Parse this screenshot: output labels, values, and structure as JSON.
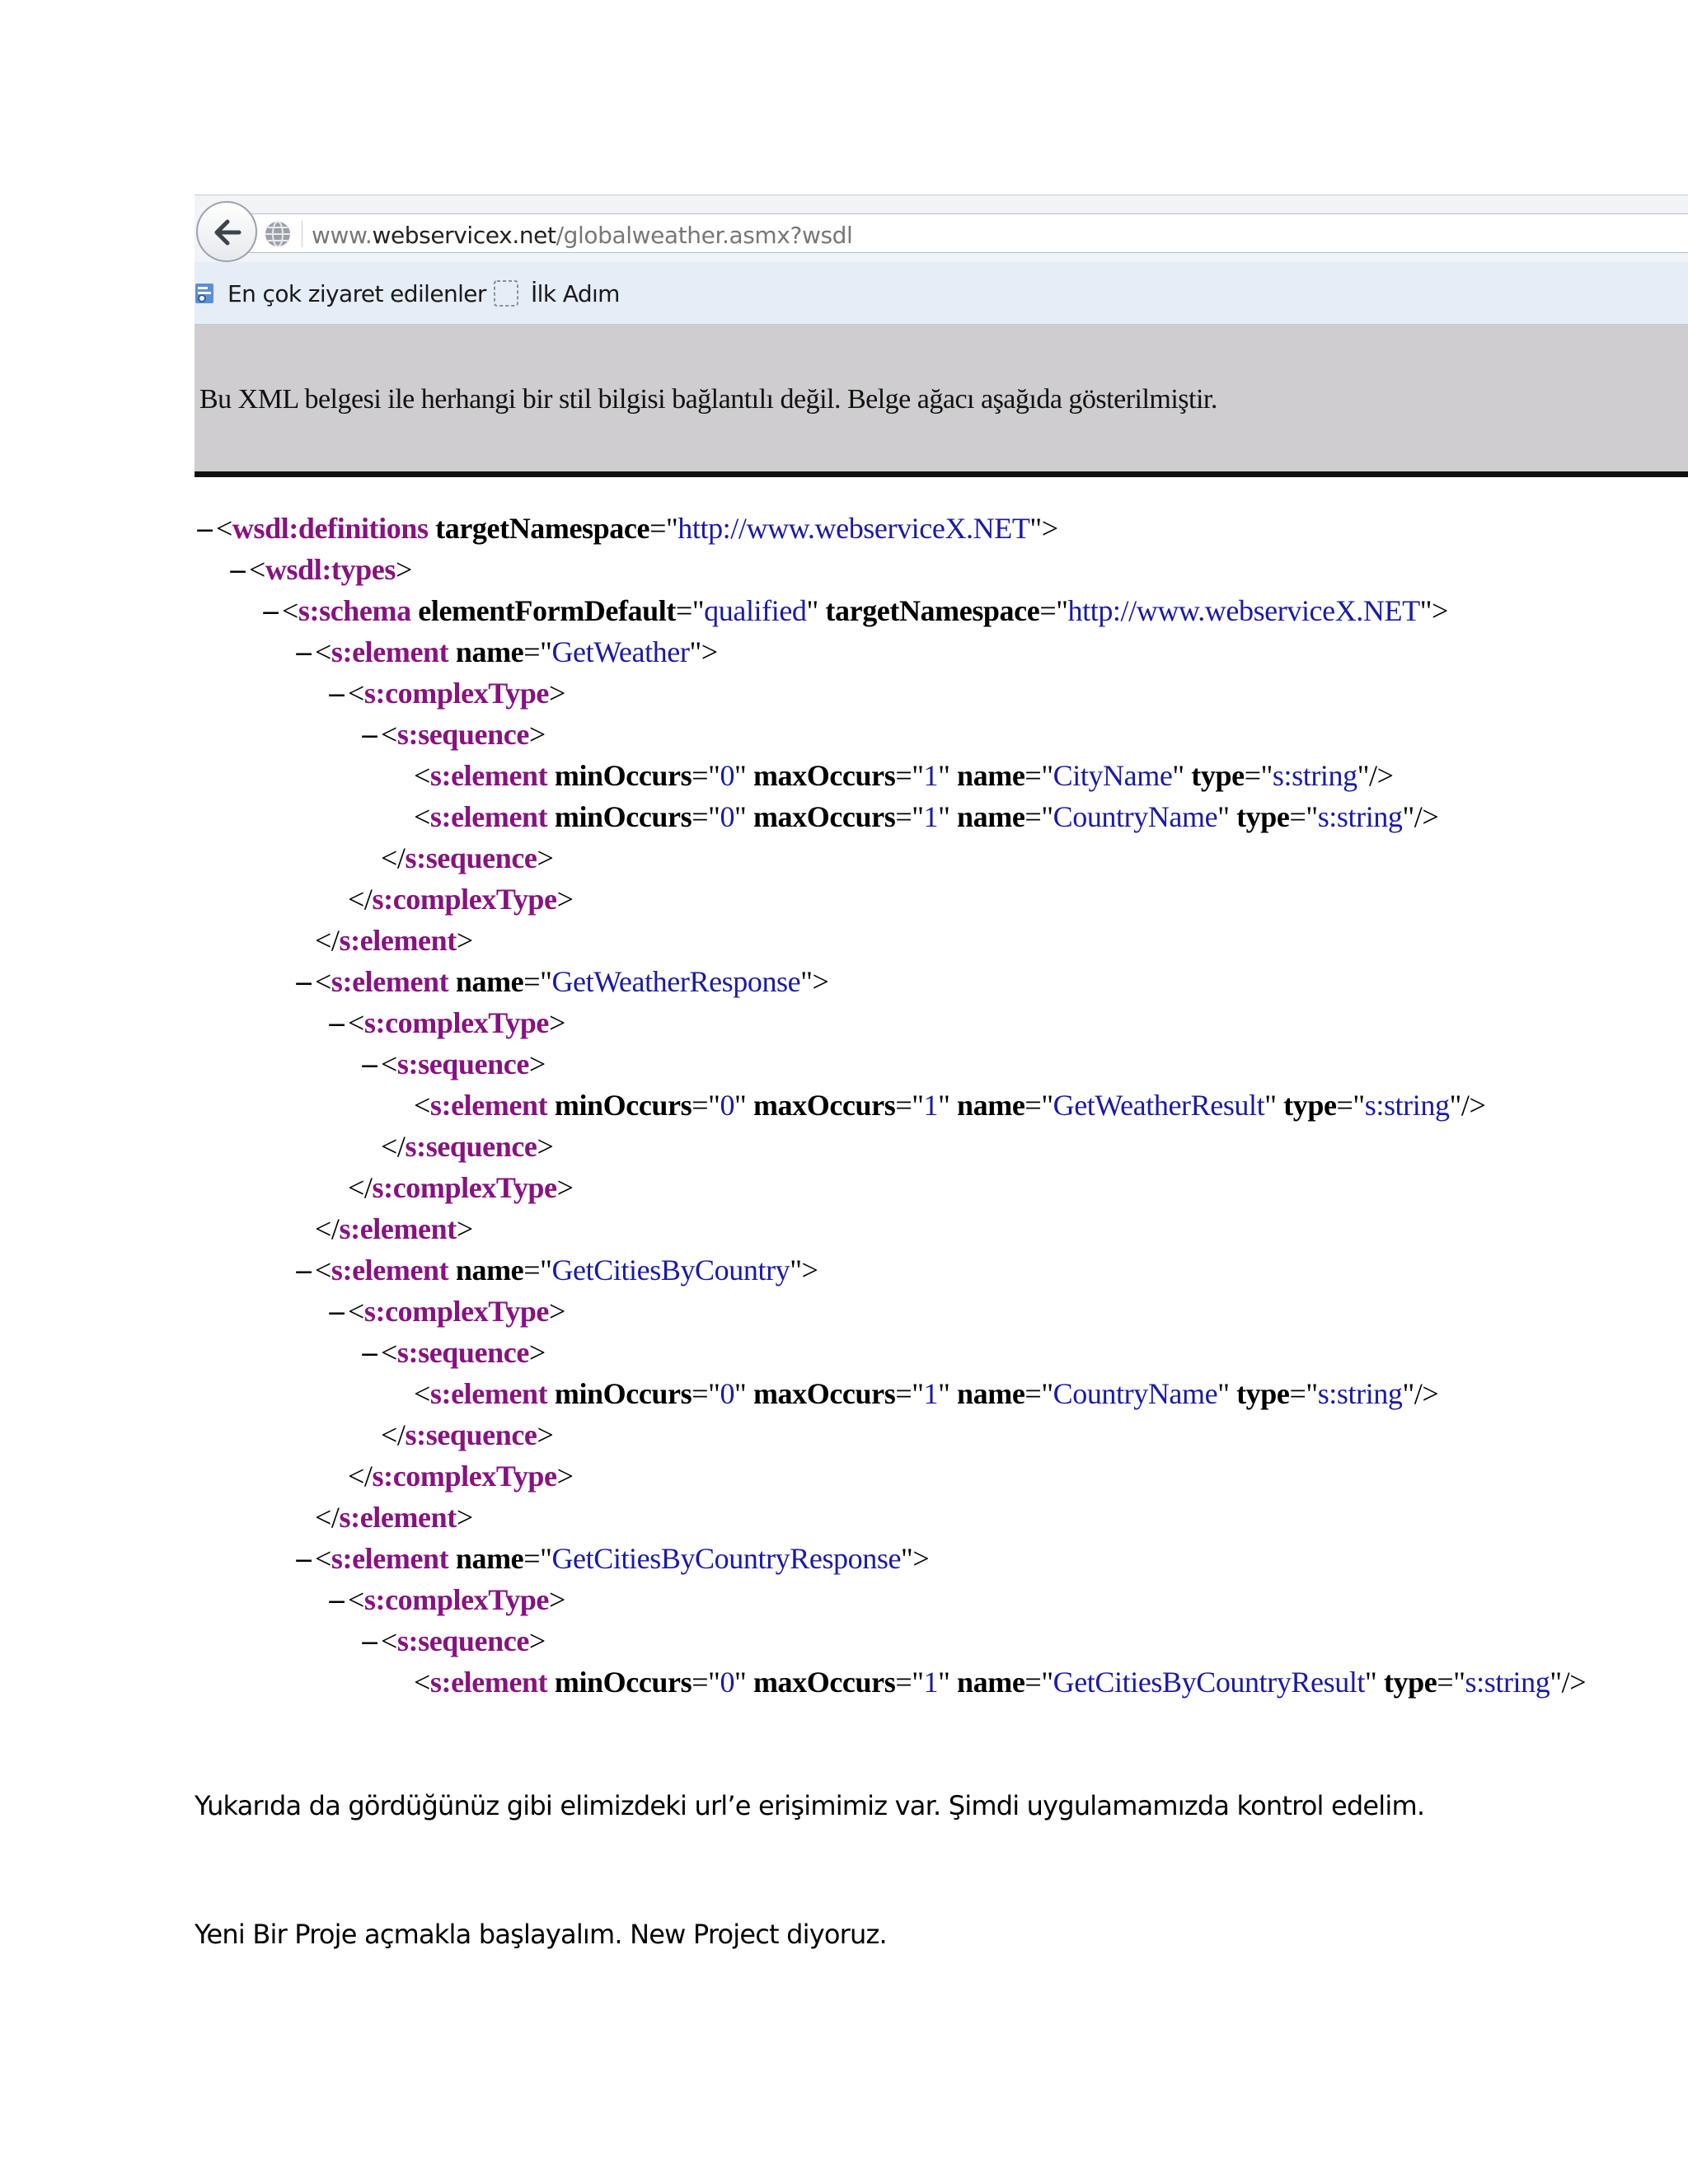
{
  "browser": {
    "url_host_prefix": "www.",
    "url_host": "webservicex.net",
    "url_path": "/globalweather.asmx?wsdl",
    "bookmarks": [
      {
        "label": "En çok ziyaret edilenler",
        "icon": "most-visited-icon"
      },
      {
        "label": "İlk Adım",
        "icon": "first-steps-icon"
      }
    ],
    "xml_notice": "Bu XML belgesi ile herhangi bir stil bilgisi bağlantılı değil. Belge ağacı aşağıda gösterilmiştir."
  },
  "xml_lines": [
    {
      "indent": 0,
      "toggle": "−",
      "parts": [
        [
          "punct",
          "<"
        ],
        [
          "tag",
          "wsdl:definitions"
        ],
        [
          "attr",
          " targetNamespace"
        ],
        [
          "punct",
          "=\""
        ],
        [
          "val",
          "http://www.webserviceX.NET"
        ],
        [
          "punct",
          "\">"
        ]
      ]
    },
    {
      "indent": 1,
      "toggle": "−",
      "parts": [
        [
          "punct",
          "<"
        ],
        [
          "tag",
          "wsdl:types"
        ],
        [
          "punct",
          ">"
        ]
      ]
    },
    {
      "indent": 2,
      "toggle": "−",
      "parts": [
        [
          "punct",
          "<"
        ],
        [
          "tag",
          "s:schema"
        ],
        [
          "attr",
          " elementFormDefault"
        ],
        [
          "punct",
          "=\""
        ],
        [
          "val",
          "qualified"
        ],
        [
          "punct",
          "\""
        ],
        [
          "attr",
          " targetNamespace"
        ],
        [
          "punct",
          "=\""
        ],
        [
          "val",
          "http://www.webserviceX.NET"
        ],
        [
          "punct",
          "\">"
        ]
      ]
    },
    {
      "indent": 3,
      "toggle": "−",
      "parts": [
        [
          "punct",
          "<"
        ],
        [
          "tag",
          "s:element"
        ],
        [
          "attr",
          " name"
        ],
        [
          "punct",
          "=\""
        ],
        [
          "val",
          "GetWeather"
        ],
        [
          "punct",
          "\">"
        ]
      ]
    },
    {
      "indent": 4,
      "toggle": "−",
      "parts": [
        [
          "punct",
          "<"
        ],
        [
          "tag",
          "s:complexType"
        ],
        [
          "punct",
          ">"
        ]
      ]
    },
    {
      "indent": 5,
      "toggle": "−",
      "parts": [
        [
          "punct",
          "<"
        ],
        [
          "tag",
          "s:sequence"
        ],
        [
          "punct",
          ">"
        ]
      ]
    },
    {
      "indent": 6,
      "toggle": "",
      "parts": [
        [
          "punct",
          "<"
        ],
        [
          "tag",
          "s:element"
        ],
        [
          "attr",
          " minOccurs"
        ],
        [
          "punct",
          "=\""
        ],
        [
          "val",
          "0"
        ],
        [
          "punct",
          "\""
        ],
        [
          "attr",
          " maxOccurs"
        ],
        [
          "punct",
          "=\""
        ],
        [
          "val",
          "1"
        ],
        [
          "punct",
          "\""
        ],
        [
          "attr",
          " name"
        ],
        [
          "punct",
          "=\""
        ],
        [
          "val",
          "CityName"
        ],
        [
          "punct",
          "\""
        ],
        [
          "attr",
          " type"
        ],
        [
          "punct",
          "=\""
        ],
        [
          "val",
          "s:string"
        ],
        [
          "punct",
          "\"/>"
        ]
      ]
    },
    {
      "indent": 6,
      "toggle": "",
      "parts": [
        [
          "punct",
          "<"
        ],
        [
          "tag",
          "s:element"
        ],
        [
          "attr",
          " minOccurs"
        ],
        [
          "punct",
          "=\""
        ],
        [
          "val",
          "0"
        ],
        [
          "punct",
          "\""
        ],
        [
          "attr",
          " maxOccurs"
        ],
        [
          "punct",
          "=\""
        ],
        [
          "val",
          "1"
        ],
        [
          "punct",
          "\""
        ],
        [
          "attr",
          " name"
        ],
        [
          "punct",
          "=\""
        ],
        [
          "val",
          "CountryName"
        ],
        [
          "punct",
          "\""
        ],
        [
          "attr",
          " type"
        ],
        [
          "punct",
          "=\""
        ],
        [
          "val",
          "s:string"
        ],
        [
          "punct",
          "\"/>"
        ]
      ]
    },
    {
      "indent": 5,
      "toggle": "",
      "parts": [
        [
          "punct",
          "</"
        ],
        [
          "tag",
          "s:sequence"
        ],
        [
          "punct",
          ">"
        ]
      ]
    },
    {
      "indent": 4,
      "toggle": "",
      "parts": [
        [
          "punct",
          "</"
        ],
        [
          "tag",
          "s:complexType"
        ],
        [
          "punct",
          ">"
        ]
      ]
    },
    {
      "indent": 3,
      "toggle": "",
      "parts": [
        [
          "punct",
          "</"
        ],
        [
          "tag",
          "s:element"
        ],
        [
          "punct",
          ">"
        ]
      ]
    },
    {
      "indent": 3,
      "toggle": "−",
      "parts": [
        [
          "punct",
          "<"
        ],
        [
          "tag",
          "s:element"
        ],
        [
          "attr",
          " name"
        ],
        [
          "punct",
          "=\""
        ],
        [
          "val",
          "GetWeatherResponse"
        ],
        [
          "punct",
          "\">"
        ]
      ]
    },
    {
      "indent": 4,
      "toggle": "−",
      "parts": [
        [
          "punct",
          "<"
        ],
        [
          "tag",
          "s:complexType"
        ],
        [
          "punct",
          ">"
        ]
      ]
    },
    {
      "indent": 5,
      "toggle": "−",
      "parts": [
        [
          "punct",
          "<"
        ],
        [
          "tag",
          "s:sequence"
        ],
        [
          "punct",
          ">"
        ]
      ]
    },
    {
      "indent": 6,
      "toggle": "",
      "parts": [
        [
          "punct",
          "<"
        ],
        [
          "tag",
          "s:element"
        ],
        [
          "attr",
          " minOccurs"
        ],
        [
          "punct",
          "=\""
        ],
        [
          "val",
          "0"
        ],
        [
          "punct",
          "\""
        ],
        [
          "attr",
          " maxOccurs"
        ],
        [
          "punct",
          "=\""
        ],
        [
          "val",
          "1"
        ],
        [
          "punct",
          "\""
        ],
        [
          "attr",
          " name"
        ],
        [
          "punct",
          "=\""
        ],
        [
          "val",
          "GetWeatherResult"
        ],
        [
          "punct",
          "\""
        ],
        [
          "attr",
          " type"
        ],
        [
          "punct",
          "=\""
        ],
        [
          "val",
          "s:string"
        ],
        [
          "punct",
          "\"/>"
        ]
      ]
    },
    {
      "indent": 5,
      "toggle": "",
      "parts": [
        [
          "punct",
          "</"
        ],
        [
          "tag",
          "s:sequence"
        ],
        [
          "punct",
          ">"
        ]
      ]
    },
    {
      "indent": 4,
      "toggle": "",
      "parts": [
        [
          "punct",
          "</"
        ],
        [
          "tag",
          "s:complexType"
        ],
        [
          "punct",
          ">"
        ]
      ]
    },
    {
      "indent": 3,
      "toggle": "",
      "parts": [
        [
          "punct",
          "</"
        ],
        [
          "tag",
          "s:element"
        ],
        [
          "punct",
          ">"
        ]
      ]
    },
    {
      "indent": 3,
      "toggle": "−",
      "parts": [
        [
          "punct",
          "<"
        ],
        [
          "tag",
          "s:element"
        ],
        [
          "attr",
          " name"
        ],
        [
          "punct",
          "=\""
        ],
        [
          "val",
          "GetCitiesByCountry"
        ],
        [
          "punct",
          "\">"
        ]
      ]
    },
    {
      "indent": 4,
      "toggle": "−",
      "parts": [
        [
          "punct",
          "<"
        ],
        [
          "tag",
          "s:complexType"
        ],
        [
          "punct",
          ">"
        ]
      ]
    },
    {
      "indent": 5,
      "toggle": "−",
      "parts": [
        [
          "punct",
          "<"
        ],
        [
          "tag",
          "s:sequence"
        ],
        [
          "punct",
          ">"
        ]
      ]
    },
    {
      "indent": 6,
      "toggle": "",
      "parts": [
        [
          "punct",
          "<"
        ],
        [
          "tag",
          "s:element"
        ],
        [
          "attr",
          " minOccurs"
        ],
        [
          "punct",
          "=\""
        ],
        [
          "val",
          "0"
        ],
        [
          "punct",
          "\""
        ],
        [
          "attr",
          " maxOccurs"
        ],
        [
          "punct",
          "=\""
        ],
        [
          "val",
          "1"
        ],
        [
          "punct",
          "\""
        ],
        [
          "attr",
          " name"
        ],
        [
          "punct",
          "=\""
        ],
        [
          "val",
          "CountryName"
        ],
        [
          "punct",
          "\""
        ],
        [
          "attr",
          " type"
        ],
        [
          "punct",
          "=\""
        ],
        [
          "val",
          "s:string"
        ],
        [
          "punct",
          "\"/>"
        ]
      ]
    },
    {
      "indent": 5,
      "toggle": "",
      "parts": [
        [
          "punct",
          "</"
        ],
        [
          "tag",
          "s:sequence"
        ],
        [
          "punct",
          ">"
        ]
      ]
    },
    {
      "indent": 4,
      "toggle": "",
      "parts": [
        [
          "punct",
          "</"
        ],
        [
          "tag",
          "s:complexType"
        ],
        [
          "punct",
          ">"
        ]
      ]
    },
    {
      "indent": 3,
      "toggle": "",
      "parts": [
        [
          "punct",
          "</"
        ],
        [
          "tag",
          "s:element"
        ],
        [
          "punct",
          ">"
        ]
      ]
    },
    {
      "indent": 3,
      "toggle": "−",
      "parts": [
        [
          "punct",
          "<"
        ],
        [
          "tag",
          "s:element"
        ],
        [
          "attr",
          " name"
        ],
        [
          "punct",
          "=\""
        ],
        [
          "val",
          "GetCitiesByCountryResponse"
        ],
        [
          "punct",
          "\">"
        ]
      ]
    },
    {
      "indent": 4,
      "toggle": "−",
      "parts": [
        [
          "punct",
          "<"
        ],
        [
          "tag",
          "s:complexType"
        ],
        [
          "punct",
          ">"
        ]
      ]
    },
    {
      "indent": 5,
      "toggle": "−",
      "parts": [
        [
          "punct",
          "<"
        ],
        [
          "tag",
          "s:sequence"
        ],
        [
          "punct",
          ">"
        ]
      ]
    },
    {
      "indent": 6,
      "toggle": "",
      "parts": [
        [
          "punct",
          "<"
        ],
        [
          "tag",
          "s:element"
        ],
        [
          "attr",
          " minOccurs"
        ],
        [
          "punct",
          "=\""
        ],
        [
          "val",
          "0"
        ],
        [
          "punct",
          "\""
        ],
        [
          "attr",
          " maxOccurs"
        ],
        [
          "punct",
          "=\""
        ],
        [
          "val",
          "1"
        ],
        [
          "punct",
          "\""
        ],
        [
          "attr",
          " name"
        ],
        [
          "punct",
          "=\""
        ],
        [
          "val",
          "GetCitiesByCountryResult"
        ],
        [
          "punct",
          "\""
        ],
        [
          "attr",
          " type"
        ],
        [
          "punct",
          "=\""
        ],
        [
          "val",
          "s:string"
        ],
        [
          "punct",
          "\"/>"
        ]
      ]
    }
  ],
  "document": {
    "paragraph_1": "Yukarıda da gördüğünüz gibi elimizdeki url’e erişimimiz var. Şimdi uygulamamızda kontrol edelim.",
    "paragraph_2": "Yeni Bir Proje açmakla başlayalım. New Project diyoruz."
  }
}
